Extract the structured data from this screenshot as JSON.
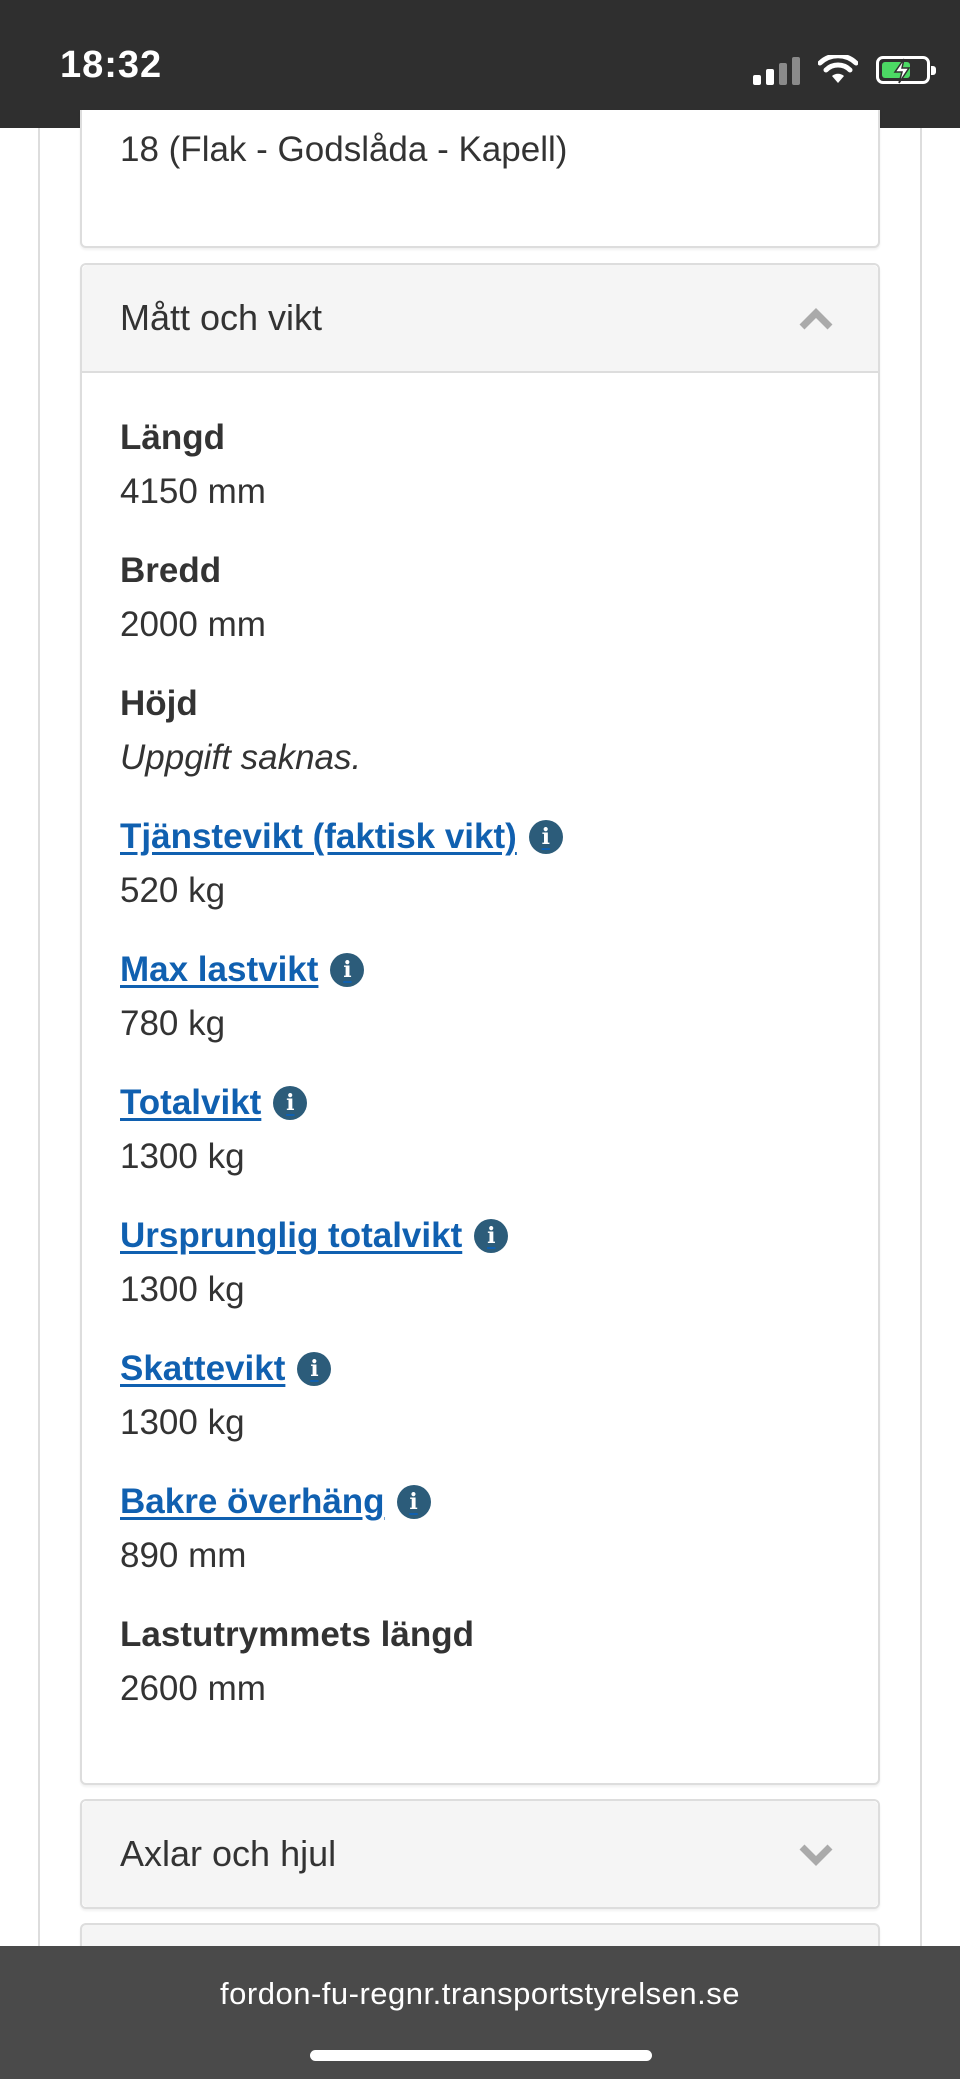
{
  "status_bar": {
    "time": "18:32"
  },
  "top_card": {
    "value": "18 (Flak - Godslåda - Kapell)"
  },
  "matt_och_vikt": {
    "title": "Mått och vikt",
    "fields": [
      {
        "label": "Längd",
        "value": "4150 mm"
      },
      {
        "label": "Bredd",
        "value": "2000 mm"
      },
      {
        "label": "Höjd",
        "value": "Uppgift saknas."
      },
      {
        "label": "Tjänstevikt (faktisk vikt)",
        "value": "520 kg"
      },
      {
        "label": "Max lastvikt",
        "value": "780 kg"
      },
      {
        "label": "Totalvikt",
        "value": "1300 kg"
      },
      {
        "label": "Ursprunglig totalvikt",
        "value": "1300 kg"
      },
      {
        "label": "Skattevikt",
        "value": "1300 kg"
      },
      {
        "label": "Bakre överhäng",
        "value": "890 mm"
      },
      {
        "label": "Lastutrymmets längd",
        "value": "2600 mm"
      }
    ]
  },
  "axlar_och_hjul": {
    "title": "Axlar och hjul"
  },
  "browser": {
    "url": "fordon-fu-regnr.transportstyrelsen.se"
  },
  "icons": {
    "info": "i"
  },
  "colors": {
    "link": "#1060b0",
    "info_icon": "#2c5c7a",
    "panel_header": "#f5f5f5"
  }
}
